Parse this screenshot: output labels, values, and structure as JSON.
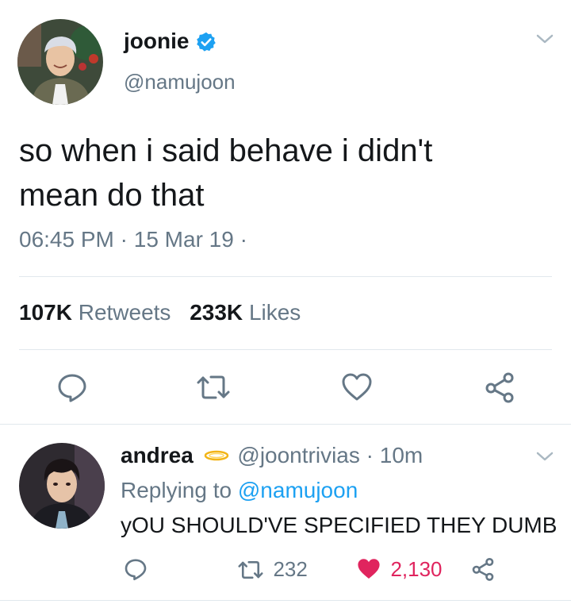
{
  "tweet": {
    "author_name": "joonie",
    "author_handle": "@namujoon",
    "verified": true,
    "text_line1": "so when i said behave i didn't",
    "text_line2": "mean do that",
    "time": "06:45 PM",
    "sep1": "·",
    "date": "15 Mar 19",
    "sep2": "·",
    "retweets_count": "107K",
    "retweets_label": "Retweets",
    "likes_count": "233K",
    "likes_label": "Likes"
  },
  "reply": {
    "author_name": "andrea",
    "author_handle": "@joontrivias",
    "sep": "·",
    "time_ago": "10m",
    "replying_label": "Replying to",
    "replying_handle": "@namujoon",
    "text": "yOU SHOULD'VE SPECIFIED THEY DUMB",
    "retweet_count": "232",
    "like_count": "2,130",
    "liked": true
  },
  "colors": {
    "accent": "#1da1f2",
    "gray": "#657786",
    "liked": "#e0245e",
    "divider": "#e1e8ed"
  },
  "icons": [
    "chevron-down-icon",
    "verified-badge-icon",
    "reply-icon",
    "retweet-icon",
    "like-icon",
    "share-icon",
    "halo-emoji-icon"
  ]
}
